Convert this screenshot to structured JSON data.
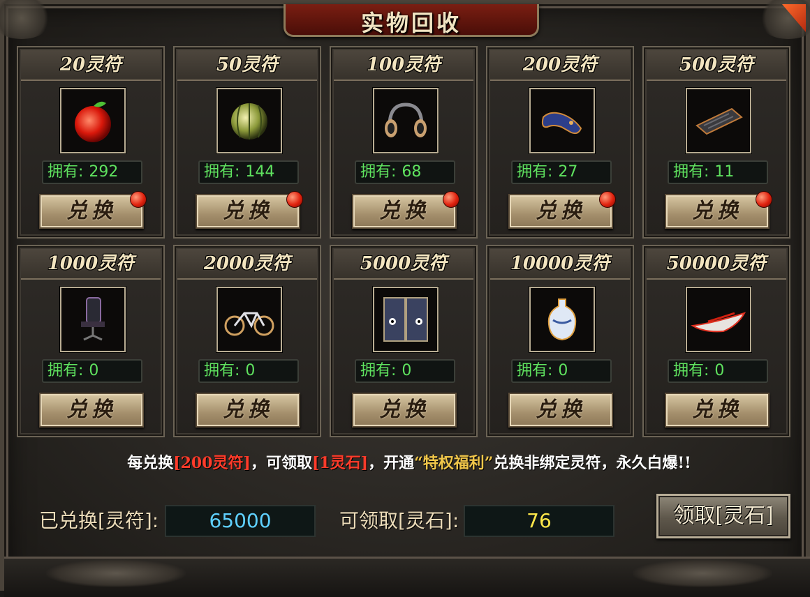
{
  "window": {
    "title": "实物回收"
  },
  "colors": {
    "owned_text": "#5fe25f",
    "exchanged_value": "#5fd0ff",
    "claimable_value": "#ffe84a",
    "notice_red": "#ff3b2a",
    "notice_gold": "#f0c64a"
  },
  "cards": [
    {
      "title": "20灵符",
      "own_label": "拥有:",
      "own_value": "292",
      "button": "兑换",
      "has_dot": true,
      "item_icon": "apple-icon"
    },
    {
      "title": "50灵符",
      "own_label": "拥有:",
      "own_value": "144",
      "button": "兑换",
      "has_dot": true,
      "item_icon": "melon-icon"
    },
    {
      "title": "100灵符",
      "own_label": "拥有:",
      "own_value": "68",
      "button": "兑换",
      "has_dot": true,
      "item_icon": "headphones-icon"
    },
    {
      "title": "200灵符",
      "own_label": "拥有:",
      "own_value": "27",
      "button": "兑换",
      "has_dot": true,
      "item_icon": "gamepad-icon"
    },
    {
      "title": "500灵符",
      "own_label": "拥有:",
      "own_value": "11",
      "button": "兑换",
      "has_dot": true,
      "item_icon": "keyboard-icon"
    },
    {
      "title": "1000灵符",
      "own_label": "拥有:",
      "own_value": "0",
      "button": "兑换",
      "has_dot": false,
      "item_icon": "gaming-chair-icon"
    },
    {
      "title": "2000灵符",
      "own_label": "拥有:",
      "own_value": "0",
      "button": "兑换",
      "has_dot": false,
      "item_icon": "bicycle-icon"
    },
    {
      "title": "5000灵符",
      "own_label": "拥有:",
      "own_value": "0",
      "button": "兑换",
      "has_dot": false,
      "item_icon": "fridge-icon"
    },
    {
      "title": "10000灵符",
      "own_label": "拥有:",
      "own_value": "0",
      "button": "兑换",
      "has_dot": false,
      "item_icon": "porcelain-vase-icon"
    },
    {
      "title": "50000灵符",
      "own_label": "拥有:",
      "own_value": "0",
      "button": "兑换",
      "has_dot": false,
      "item_icon": "yacht-icon"
    }
  ],
  "notice": {
    "part1": "每兑换",
    "hl1": "[200灵符]",
    "part2": "，可领取",
    "hl2": "[1灵石]",
    "part3": "，开通",
    "hl3": "“特权福利”",
    "part4": "兑换非绑定灵符，永久白爆!!"
  },
  "bottom": {
    "exchanged_label": "已兑换[灵符]:",
    "exchanged_value": "65000",
    "claimable_label": "可领取[灵石]:",
    "claimable_value": "76",
    "claim_button": "领取[灵石]"
  }
}
